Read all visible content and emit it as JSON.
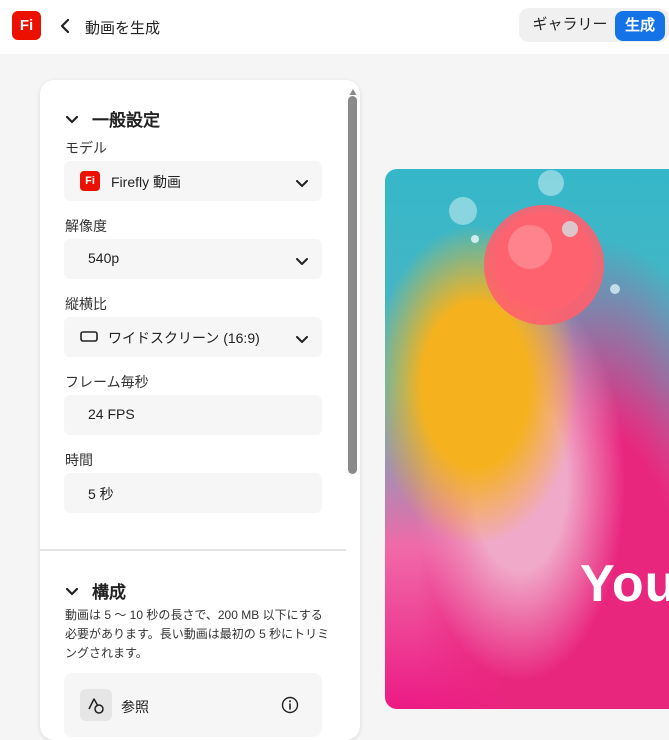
{
  "header": {
    "logo_text": "Fi",
    "title": "動画を生成",
    "gallery_label": "ギャラリー",
    "generate_label": "生成"
  },
  "general": {
    "heading": "一般設定",
    "model": {
      "label": "モデル",
      "value": "Firefly 動画",
      "badge": "Fi"
    },
    "resolution": {
      "label": "解像度",
      "value": "540p"
    },
    "aspect": {
      "label": "縦横比",
      "value": "ワイドスクリーン (16:9)"
    },
    "fps": {
      "label": "フレーム毎秒",
      "value": "24 FPS"
    },
    "duration": {
      "label": "時間",
      "value": "5 秒"
    }
  },
  "composition": {
    "heading": "構成",
    "description": "動画は 5 ～ 10 秒の長さで、200 MB 以下にする必要があります。長い動画は最初の 5 秒にトリミングされます。",
    "reference_label": "参照"
  },
  "preview": {
    "overlay_text": "You"
  },
  "colors": {
    "accent": "#1473e6",
    "brand": "#eb1000"
  }
}
